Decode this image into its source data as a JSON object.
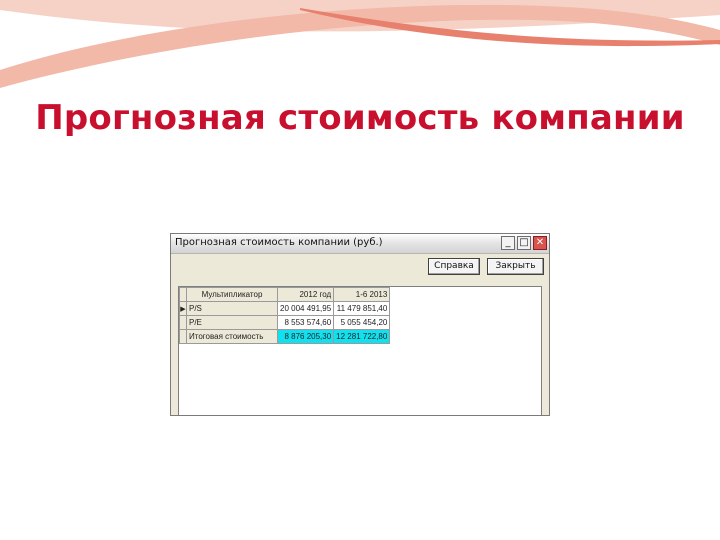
{
  "slide": {
    "title": "Прогнозная стоимость компании",
    "decor_colors": [
      "#f2b8a8",
      "#e8806e",
      "#f6d2c6"
    ]
  },
  "window": {
    "title": "Прогнозная стоимость компании (руб.)",
    "controls": [
      "minimize-icon",
      "maximize-icon",
      "close-icon"
    ],
    "buttons": {
      "help_label": "Справка",
      "close_label": "Закрыть"
    }
  },
  "table": {
    "headers": [
      "Мультипликатор",
      "2012 год",
      "1-6 2013"
    ],
    "rows": [
      {
        "label": "P/S",
        "values": [
          "20 004 491,95",
          "11 479 851,40"
        ],
        "selected": true
      },
      {
        "label": "P/E",
        "values": [
          "8 553 574,60",
          "5 055 454,20"
        ],
        "selected": false
      },
      {
        "label": "Итоговая стоимость",
        "values": [
          "8 876 205,30",
          "12 281 722,80"
        ],
        "selected": false,
        "highlight": true
      }
    ],
    "highlight_color": "#13e0ef"
  }
}
